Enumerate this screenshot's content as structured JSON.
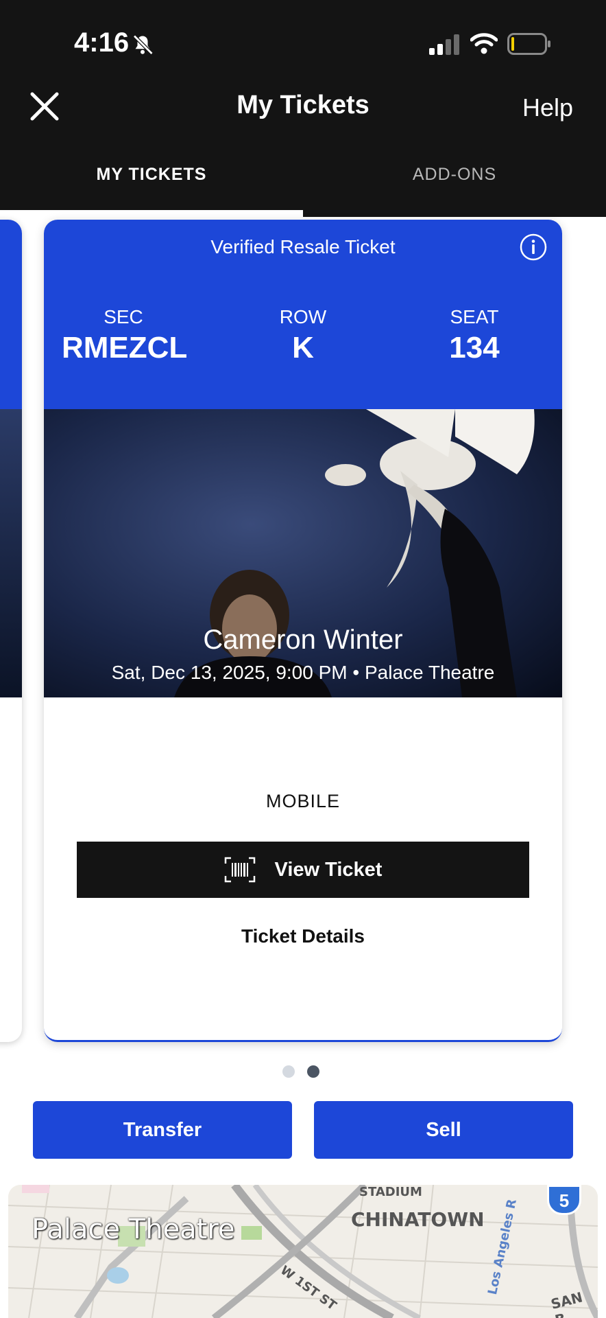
{
  "status_bar": {
    "time": "4:16"
  },
  "header": {
    "title": "My Tickets",
    "help": "Help"
  },
  "tabs": [
    {
      "label": "MY TICKETS",
      "active": true
    },
    {
      "label": "ADD-ONS",
      "active": false
    }
  ],
  "ticket": {
    "banner": "Verified Resale Ticket",
    "section_label": "SEC",
    "section": "RMEZCL",
    "row_label": "ROW",
    "row": "K",
    "seat_label": "SEAT",
    "seat": "134",
    "event_name": "Cameron Winter",
    "event_meta": "Sat, Dec 13, 2025, 9:00 PM • Palace Theatre",
    "delivery": "MOBILE",
    "view_ticket": "View Ticket",
    "details": "Ticket Details"
  },
  "pager": {
    "total": 2,
    "current": 2
  },
  "actions": {
    "transfer": "Transfer",
    "sell": "Sell"
  },
  "map": {
    "venue": "Palace Theatre",
    "labels": {
      "stadium": "STADIUM",
      "chinatown": "CHINATOWN",
      "street": "W 1ST ST",
      "avenue": "Los Angeles R",
      "san": "SAN B",
      "shield": "5"
    }
  },
  "colors": {
    "header_bg": "#141414",
    "accent": "#1d47d8"
  }
}
